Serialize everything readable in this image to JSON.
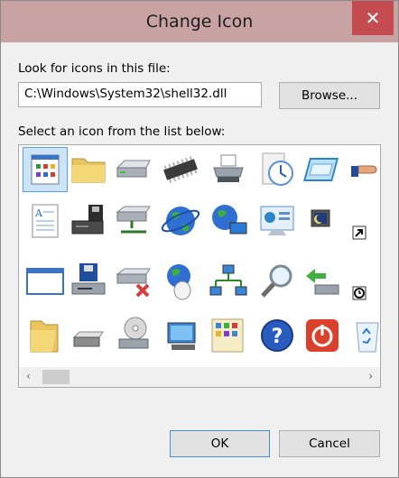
{
  "dialog": {
    "title": "Change Icon"
  },
  "labels": {
    "look_for": "Look for icons in this file:",
    "select_icon": "Select an icon from the list below:"
  },
  "file_path": "C:\\Windows\\System32\\shell32.dll",
  "buttons": {
    "browse": "Browse...",
    "ok": "OK",
    "cancel": "Cancel",
    "close": "✕"
  },
  "scroll_arrows": {
    "left": "‹",
    "right": "›"
  },
  "icons": [
    "window-app-icon",
    "folder-icon",
    "drive-icon",
    "memory-chip-icon",
    "printer-icon",
    "clock-document-icon",
    "window-frame-icon",
    "hand-share-icon",
    "document-text-icon",
    "floppy-shortcut-icon",
    "network-drive-icon",
    "globe-icon",
    "globe-computer-icon",
    "control-panel-icon",
    "monitor-moon-icon",
    "shortcut-arrow-icon",
    "window-blank-icon",
    "floppy-drive-icon",
    "network-drive-disconnect-icon",
    "globe-mouse-icon",
    "network-computers-icon",
    "magnifier-icon",
    "arrow-drive-icon",
    "clock-badge-icon",
    "folder-open-icon",
    "hard-drive-icon",
    "cd-drive-icon",
    "computer-icon",
    "control-panel-list-icon",
    "help-icon",
    "power-icon",
    "recycle-bin-icon"
  ],
  "selected_icon": 0
}
